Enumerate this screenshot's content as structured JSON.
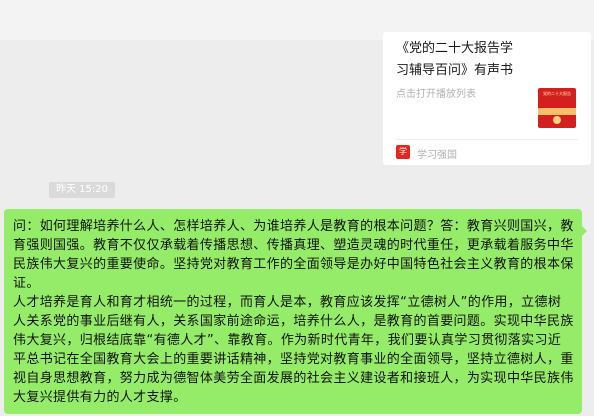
{
  "card": {
    "title": "《党的二十大报告学习辅导百问》有声书",
    "subtitle": "点击打开播放列表",
    "cover_text": "党的二十大报告",
    "brand_icon": "学",
    "source": "学习强国"
  },
  "timestamp": "昨天 15:20",
  "message": {
    "paragraph1": "问：如何理解培养什么人、怎样培养人、为谁培养人是教育的根本问题？答：教育兴则国兴，教育强则国强。教育不仅仅承载着传播思想、传播真理、塑造灵魂的时代重任，更承载着服务中华民族伟大复兴的重要使命。坚持党对教育工作的全面领导是办好中国特色社会主义教育的根本保证。",
    "paragraph2": "人才培养是育人和育才相统一的过程，而育人是本，教育应该发挥“立德树人”的作用，立德树人关系党的事业后继有人，关系国家前途命运，培养什么人，是教育的首要问题。实现中华民族伟大复兴，归根结底靠“有德人才”、靠教育。作为新时代青年，我们要认真学习贯彻落实习近平总书记在全国教育大会上的重要讲话精神，坚持党对教育事业的全面领导，坚持立德树人，重视自身思想教育，努力成为德智体美劳全面发展的社会主义建设者和接班人，为实现中华民族伟大复兴提供有力的人才支撑。"
  },
  "colors": {
    "bubble": "#95ec69",
    "background": "#ededed",
    "brand_red": "#e0281d"
  }
}
